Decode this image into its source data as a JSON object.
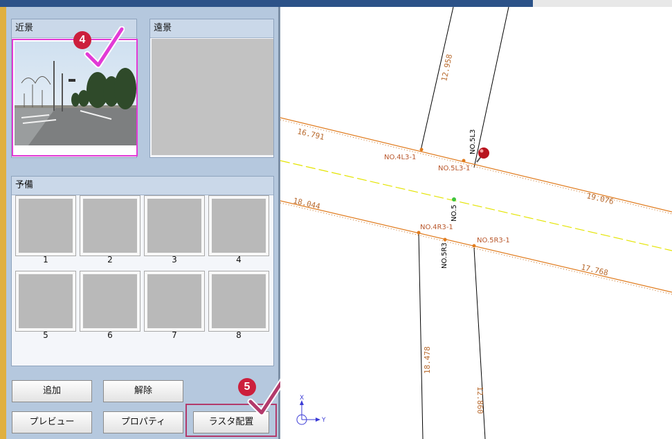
{
  "panel": {
    "near_label": "近景",
    "far_label": "遠景",
    "spare_label": "予備",
    "slots": [
      {
        "label": "1"
      },
      {
        "label": "2"
      },
      {
        "label": "3"
      },
      {
        "label": "4"
      },
      {
        "label": "5"
      },
      {
        "label": "6"
      },
      {
        "label": "7"
      },
      {
        "label": "8"
      }
    ]
  },
  "buttons": {
    "add": "追加",
    "release": "解除",
    "preview": "プレビュー",
    "properties": "プロパティ",
    "raster_place": "ラスタ配置"
  },
  "steps": {
    "step4": "4",
    "step5": "5"
  },
  "drawing": {
    "measurements": {
      "m1": "12.958",
      "m2": "16.791",
      "m3": "19.076",
      "m4": "18.044",
      "m5": "17.768",
      "m6": "18.478",
      "m7": "12.860"
    },
    "points": {
      "no4l3": "NO.4L3-1",
      "no5l3_1": "NO.5L3-1",
      "no5l3": "NO.5L3",
      "no5": "NO.5",
      "no4r3": "NO.4R3-1",
      "no5r3": "NO.5R3",
      "no5r3_1": "NO.5R3-1"
    },
    "axis_x": "X",
    "axis_y": "Y"
  },
  "colors": {
    "accent_pink": "#e23ad6",
    "badge_red": "#cc1f3c",
    "road_orange": "#e07b1d",
    "center_yellow": "#e4e400"
  }
}
